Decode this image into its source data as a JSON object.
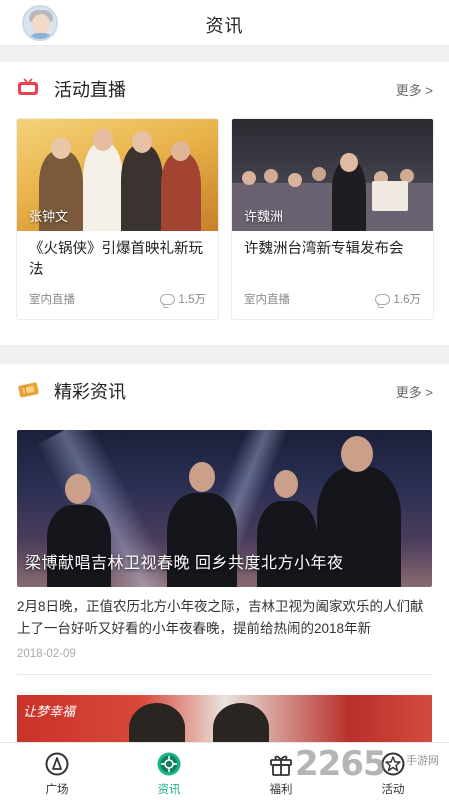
{
  "header": {
    "title": "资讯"
  },
  "live": {
    "title": "活动直播",
    "more": "更多 >",
    "cards": [
      {
        "caption": "张钟文",
        "title": "《火锅侠》引爆首映礼新玩法",
        "meta": "室内直播",
        "count": "1.5万"
      },
      {
        "caption": "许魏洲",
        "title": "许魏洲台湾新专辑发布会",
        "meta": "室内直播",
        "count": "1.6万"
      }
    ]
  },
  "news": {
    "title": "精彩资讯",
    "more": "更多 >",
    "featured": {
      "caption": "梁博献唱吉林卫视春晚 回乡共度北方小年夜",
      "summary": "2月8日晚，正值农历北方小年夜之际，吉林卫视为阖家欢乐的人们献上了一台好听又好看的小年夜春晚，提前给热闹的2018年新",
      "date": "2018-02-09"
    },
    "next_thumb_caption": "让梦幸福"
  },
  "tabs": [
    {
      "label": "广场",
      "icon": "plaza-icon"
    },
    {
      "label": "资讯",
      "icon": "news-icon"
    },
    {
      "label": "福利",
      "icon": "gift-icon"
    },
    {
      "label": "活动",
      "icon": "activity-icon"
    }
  ],
  "active_tab": "资讯",
  "watermark": {
    "number": "2265",
    "text": "手游网"
  },
  "colors": {
    "accent": "#19b48a",
    "live_icon": "#e8434f",
    "news_icon": "#e8a23a"
  }
}
